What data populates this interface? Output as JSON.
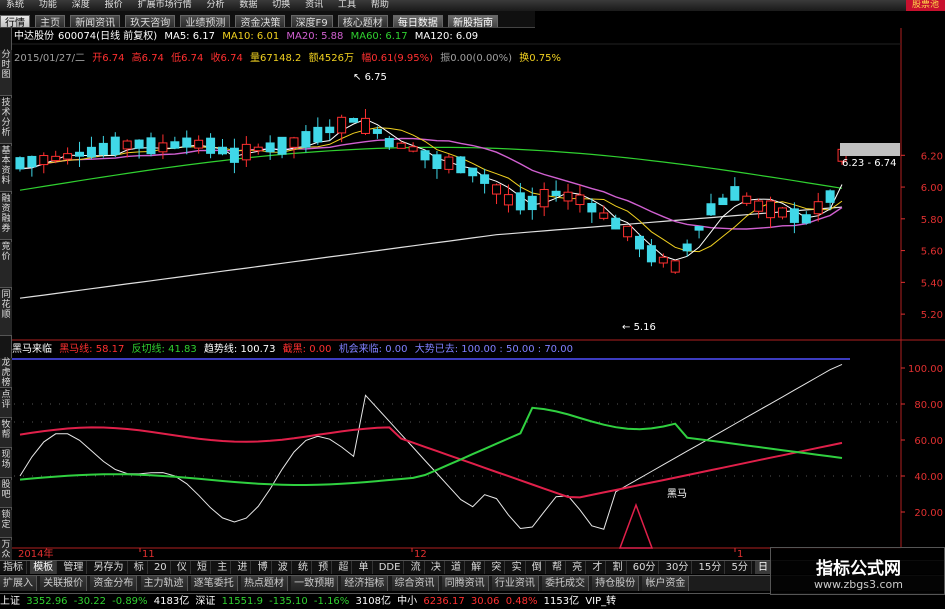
{
  "menu": [
    "系统",
    "功能",
    "深度",
    "报价",
    "扩展市场行情",
    "分析",
    "数据",
    "切换",
    "资讯",
    "工具",
    "帮助"
  ],
  "brand": "股票池",
  "tabs": [
    {
      "label": "行情"
    },
    {
      "label": "主页"
    },
    {
      "label": "新闻资讯"
    },
    {
      "label": "玖天咨询"
    },
    {
      "label": "业绩预测"
    },
    {
      "label": "资金决策"
    },
    {
      "label": "深度F9"
    },
    {
      "label": "核心题材"
    },
    {
      "label": "每日数据"
    },
    {
      "label": "新股指南"
    }
  ],
  "left_labels": [
    "分时图",
    "技术分析",
    "基本资料",
    "融资融券",
    "竞价",
    "同花顺"
  ],
  "left_labels_lower": [
    "龙虎榜",
    "点评",
    "牧帮",
    "现场",
    "股吧",
    "锁定",
    "万众"
  ],
  "stock": {
    "name": "中达股份",
    "code": "600074(日线 前复权)",
    "ma5": "MA5: 6.17",
    "ma10": "MA10: 6.01",
    "ma20": "MA20: 5.88",
    "ma60": "MA60: 6.17",
    "ma120": "MA120: 6.09"
  },
  "bar_info": {
    "date": "2015/01/27/二",
    "open": "开6.74",
    "high": "高6.74",
    "low": "低6.74",
    "close": "收6.74",
    "vol": "量67148.2",
    "amount": "额4526万",
    "change": "幅0.61(9.95%)",
    "amp": "振0.00(0.00%)",
    "turnover": "换0.75%"
  },
  "annotations": {
    "high": "6.75",
    "low": "5.16",
    "last": "6.23 - 6.74"
  },
  "indicator": {
    "name": "黑马来临",
    "heima": "黑马线: 58.17",
    "fanqie": "反切线: 41.83",
    "qushi": "趋势线: 100.73",
    "jiema": "截黑: 0.00",
    "jihui": "机会来临: 0.00",
    "dashi": "大势已去: 100.00 : 50.00 : 70.00",
    "label_heima": "黑马"
  },
  "price_axis": [
    "6.20",
    "6.00",
    "5.80",
    "5.60",
    "5.40",
    "5.20"
  ],
  "ind_axis": [
    "100.00",
    "80.00",
    "60.00",
    "40.00",
    "20.00"
  ],
  "time_labels": [
    "2014年",
    "11",
    "12",
    "1"
  ],
  "tools": [
    "指标",
    "模板",
    "管理",
    "另存为",
    "标",
    "20",
    "仪",
    "短",
    "主",
    "进",
    "博",
    "波",
    "统",
    "预",
    "超",
    "单",
    "DDE",
    "流",
    "决",
    "道",
    "解",
    "突",
    "实",
    "倒",
    "帮",
    "亮",
    "才",
    "割",
    "60分",
    "30分",
    "15分",
    "5分",
    "日"
  ],
  "pages": [
    "扩展入",
    "关联报价",
    "资金分布",
    "主力轨迹",
    "逐笔委托",
    "热点题材",
    "一致预期",
    "经济指标",
    "综合资讯",
    "同腾资讯",
    "行业资讯",
    "委托成交",
    "持仓股份",
    "帐户资金"
  ],
  "status": {
    "sh_label": "上证",
    "sh_val": "3352.96",
    "sh_chg": "-30.22",
    "sh_pct": "-0.89%",
    "sh_amt": "4183亿",
    "sz_label": "深证",
    "sz_val": "11551.9",
    "sz_chg": "-135.10",
    "sz_pct": "-1.16%",
    "sz_amt": "3108亿",
    "zx_label": "中小",
    "zx_val": "6236.17",
    "zx_chg": "30.06",
    "zx_pct": "0.48%",
    "zx_amt": "1153亿",
    "vip": "VIP_转"
  },
  "watermark": {
    "title": "指标公式网",
    "url": "www.zbgs3.com"
  },
  "colors": {
    "up": "#ff3030",
    "down": "#40d8e8",
    "ma5": "#ffffff",
    "ma10": "#f0d020",
    "ma20": "#d060d0",
    "ma60": "#30d030",
    "ma120": "#e0e0e0",
    "heima_line": "#e0204a",
    "fanqie_line": "#30d040",
    "qushi_line": "#e8e8e8"
  },
  "chart_data": {
    "type": "candlestick",
    "price_range": [
      5.1,
      6.8
    ],
    "indicator_range": [
      0,
      105
    ]
  }
}
